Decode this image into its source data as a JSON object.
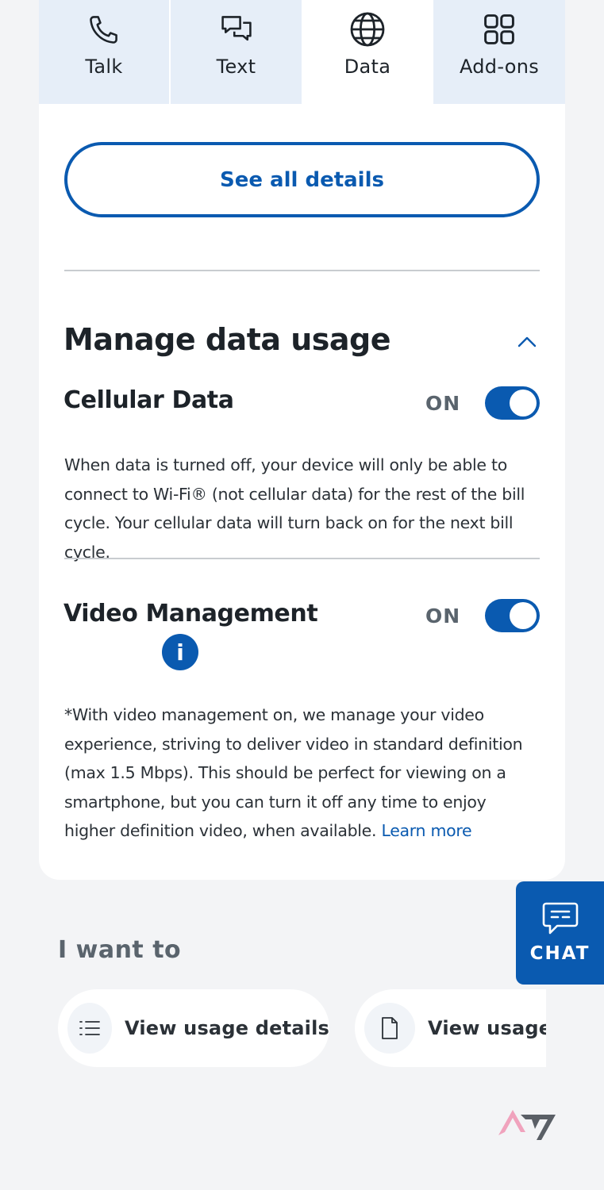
{
  "tabs": [
    {
      "label": "Talk",
      "icon": "phone-icon",
      "active": false
    },
    {
      "label": "Text",
      "icon": "chat-bubbles-icon",
      "active": false
    },
    {
      "label": "Data",
      "icon": "globe-icon",
      "active": true
    },
    {
      "label": "Add-ons",
      "icon": "grid-icon",
      "active": false
    }
  ],
  "see_all_label": "See all details",
  "manage": {
    "title": "Manage data usage",
    "cellular": {
      "title": "Cellular Data",
      "status": "ON",
      "description": "When data is turned off, your device will only be able to connect to Wi-Fi® (not cellular data) for the rest of the bill cycle. Your cellular data will turn back on for the next bill cycle."
    },
    "video": {
      "title": "Video Management",
      "status": "ON",
      "info_glyph": "i",
      "description": "*With video management on, we manage your video experience, striving to deliver video in standard definition (max 1.5 Mbps). This should be perfect for viewing on a smartphone, but you can turn it off any time to enjoy higher definition video, when available.",
      "learn_more": "Learn more"
    }
  },
  "chat_label": "CHAT",
  "want_to": {
    "title": "I want to",
    "actions": [
      {
        "label": "View usage details",
        "icon": "list-icon"
      },
      {
        "label": "View usage r",
        "icon": "document-icon"
      }
    ]
  },
  "colors": {
    "accent": "#0a5ab0",
    "tab_bg": "#e6eef8",
    "page_bg": "#f3f4f6"
  }
}
